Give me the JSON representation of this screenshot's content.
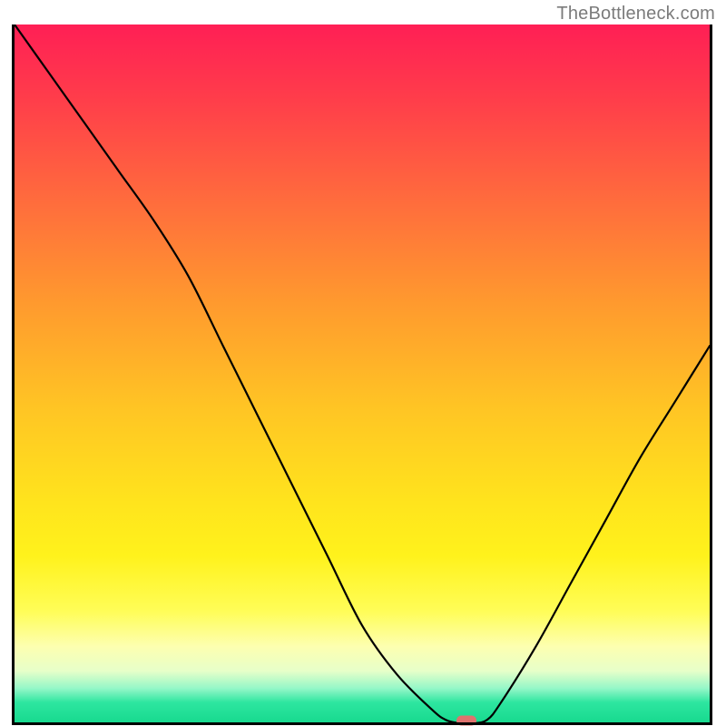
{
  "attribution": "TheBottleneck.com",
  "chart_data": {
    "type": "line",
    "x": [
      0,
      5,
      10,
      15,
      20,
      25,
      30,
      35,
      40,
      45,
      50,
      55,
      60,
      62,
      64,
      66,
      68,
      70,
      75,
      80,
      85,
      90,
      95,
      100
    ],
    "y": [
      100,
      93,
      86,
      79,
      72,
      64,
      54,
      44,
      34,
      24,
      14,
      7,
      2,
      0.5,
      0,
      0,
      0.5,
      3,
      11,
      20,
      29,
      38,
      46,
      54
    ],
    "title": "",
    "xlabel": "",
    "ylabel": "",
    "xlim": [
      0,
      100
    ],
    "ylim": [
      0,
      100
    ],
    "marker": {
      "x": 65,
      "y": 0
    },
    "gradient_stops": [
      {
        "pos": 0,
        "color": "#ff1f55"
      },
      {
        "pos": 10,
        "color": "#ff3b4b"
      },
      {
        "pos": 25,
        "color": "#ff6b3d"
      },
      {
        "pos": 40,
        "color": "#ff9a2e"
      },
      {
        "pos": 55,
        "color": "#ffc524"
      },
      {
        "pos": 68,
        "color": "#ffe31d"
      },
      {
        "pos": 76,
        "color": "#fff21c"
      },
      {
        "pos": 84,
        "color": "#fffd58"
      },
      {
        "pos": 89,
        "color": "#fdffb0"
      },
      {
        "pos": 92.5,
        "color": "#e7ffc9"
      },
      {
        "pos": 95,
        "color": "#95f7c8"
      },
      {
        "pos": 97,
        "color": "#2ee6a0"
      },
      {
        "pos": 100,
        "color": "#17d98e"
      }
    ]
  }
}
